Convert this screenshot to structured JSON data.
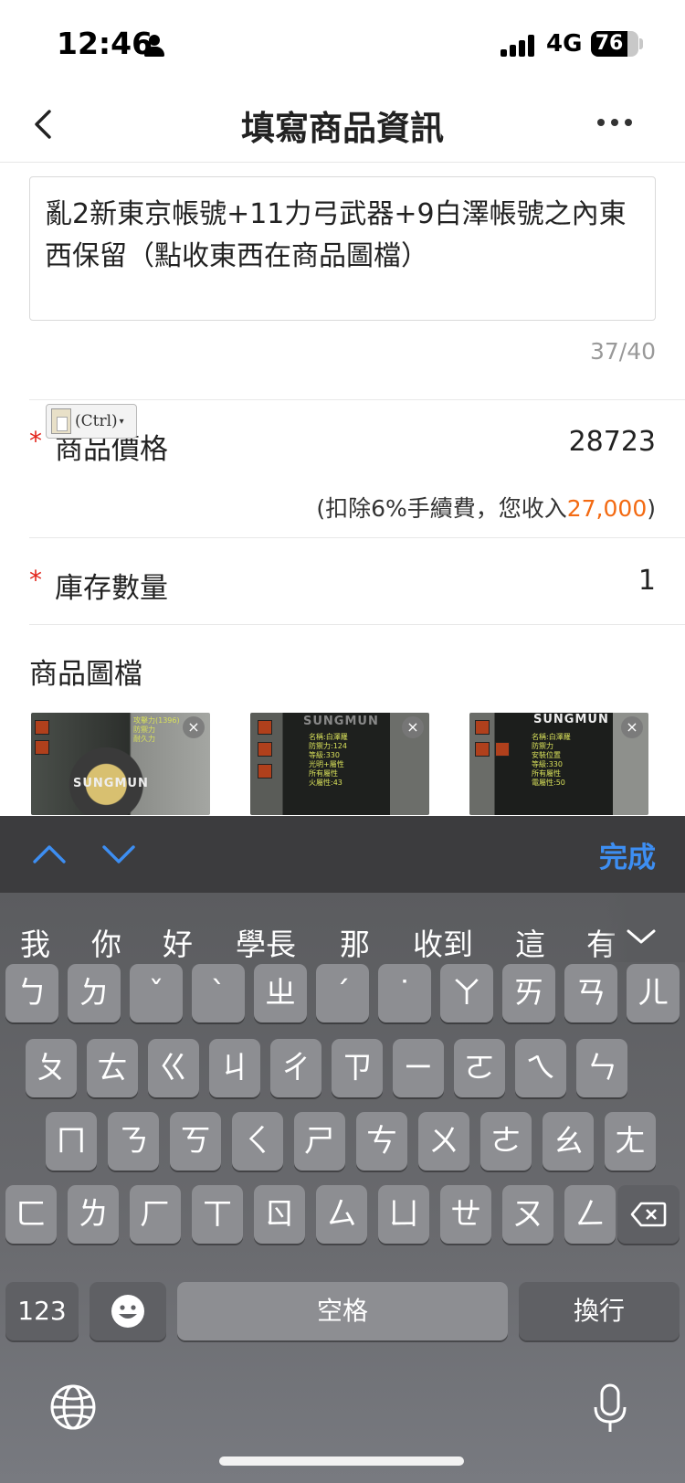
{
  "status_bar": {
    "time": "12:46",
    "network": "4G",
    "battery_level": "76",
    "battery_fraction": 0.76
  },
  "nav": {
    "title": "填寫商品資訊",
    "back_icon": "chevron-left-icon",
    "more_icon": "more-dots-icon"
  },
  "product": {
    "name": "亂2新東京帳號+11力弓武器+9白澤帳號之內東西保留（點收東西在商品圖檔）",
    "char_count": "37/40"
  },
  "paste_popup": {
    "label": "(Ctrl)"
  },
  "price": {
    "required_mark": "*",
    "label": "商品價格",
    "value": "28723",
    "fee_prefix": "(扣除6%手續費，您收入",
    "fee_amount": "27,000",
    "fee_suffix": ")"
  },
  "stock": {
    "required_mark": "*",
    "label": "庫存數量",
    "value": "1"
  },
  "images": {
    "section_title": "商品圖檔",
    "items": [
      {
        "watermark": "SUNGMUN",
        "remove_icon": "close-icon"
      },
      {
        "watermark": "SUNGMUN",
        "remove_icon": "close-icon"
      },
      {
        "watermark": "SUNGMUN",
        "remove_icon": "close-icon"
      }
    ]
  },
  "keyboard_toolbar": {
    "done_label": "完成",
    "up_icon": "chevron-up-icon",
    "down_icon": "chevron-down-icon"
  },
  "keyboard": {
    "candidates": [
      "我",
      "你",
      "好",
      "學長",
      "那",
      "收到",
      "這",
      "有"
    ],
    "row1": [
      "ㄅ",
      "ㄉ",
      "ˇ",
      "ˋ",
      "ㄓ",
      "ˊ",
      "˙",
      "ㄚ",
      "ㄞ",
      "ㄢ",
      "ㄦ"
    ],
    "row2": [
      "ㄆ",
      "ㄊ",
      "ㄍ",
      "ㄐ",
      "ㄔ",
      "ㄗ",
      "ㄧ",
      "ㄛ",
      "ㄟ",
      "ㄣ"
    ],
    "row3": [
      "ㄇ",
      "ㄋ",
      "ㄎ",
      "ㄑ",
      "ㄕ",
      "ㄘ",
      "ㄨ",
      "ㄜ",
      "ㄠ",
      "ㄤ"
    ],
    "row4": [
      "ㄈ",
      "ㄌ",
      "ㄏ",
      "ㄒ",
      "ㄖ",
      "ㄙ",
      "ㄩ",
      "ㄝ",
      "ㄡ",
      "ㄥ"
    ],
    "numbers_label": "123",
    "space_label": "空格",
    "return_label": "換行",
    "delete_icon": "backspace-icon",
    "emoji_icon": "emoji-icon",
    "globe_icon": "globe-icon",
    "mic_icon": "microphone-icon"
  },
  "colors": {
    "accent_blue": "#3d8ef2",
    "required_red": "#e2231a",
    "income_orange": "#f36a12"
  }
}
